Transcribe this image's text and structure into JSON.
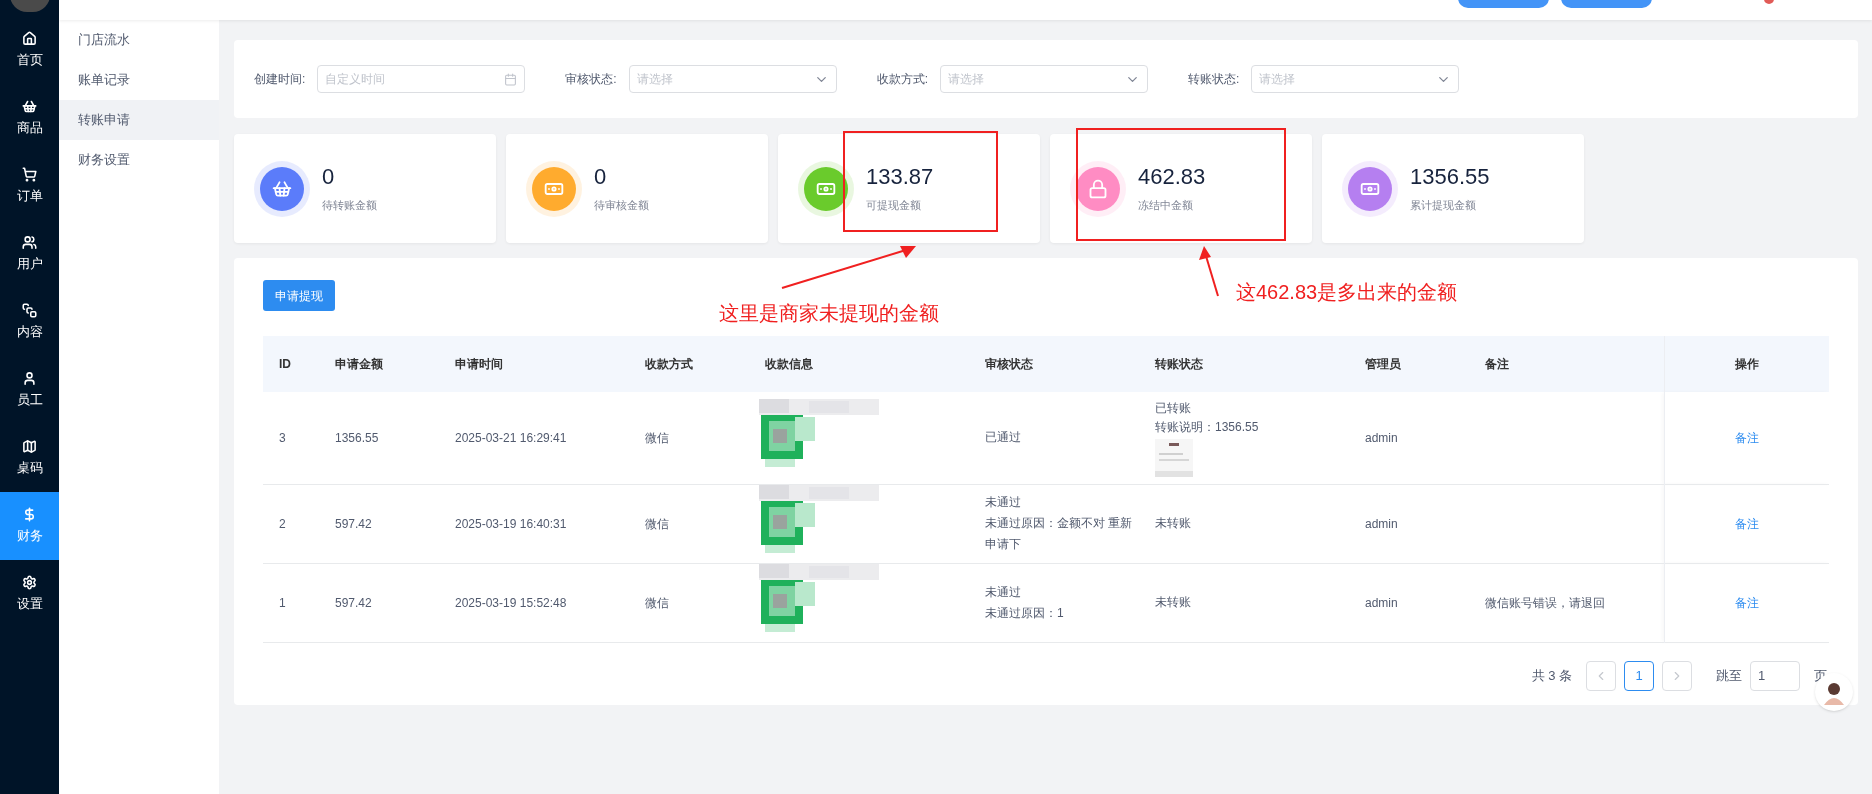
{
  "sidebar": {
    "items": [
      {
        "label": "首页",
        "selected": false
      },
      {
        "label": "商品",
        "selected": false
      },
      {
        "label": "订单",
        "selected": false
      },
      {
        "label": "用户",
        "selected": false
      },
      {
        "label": "内容",
        "selected": false
      },
      {
        "label": "员工",
        "selected": false
      },
      {
        "label": "桌码",
        "selected": false
      },
      {
        "label": "财务",
        "selected": true
      },
      {
        "label": "设置",
        "selected": false
      }
    ]
  },
  "submenu": {
    "items": [
      {
        "label": "门店流水",
        "selected": false
      },
      {
        "label": "账单记录",
        "selected": false
      },
      {
        "label": "转账申请",
        "selected": true
      },
      {
        "label": "财务设置",
        "selected": false
      }
    ]
  },
  "filters": [
    {
      "label": "创建时间:",
      "kind": "date",
      "placeholder": "自定义时间"
    },
    {
      "label": "审核状态:",
      "kind": "select",
      "placeholder": "请选择"
    },
    {
      "label": "收款方式:",
      "kind": "select",
      "placeholder": "请选择"
    },
    {
      "label": "转账状态:",
      "kind": "select",
      "placeholder": "请选择"
    }
  ],
  "stats": [
    {
      "value": "0",
      "label": "待转账金额",
      "color": "#5b7cfa"
    },
    {
      "value": "0",
      "label": "待审核金额",
      "color": "#ffab2e"
    },
    {
      "value": "133.87",
      "label": "可提现金额",
      "color": "#6acb2c"
    },
    {
      "value": "462.83",
      "label": "冻结中金额",
      "color": "#ff8cc3"
    },
    {
      "value": "1356.55",
      "label": "累计提现金额",
      "color": "#b57ff0"
    }
  ],
  "apply_button": "申请提现",
  "table": {
    "columns": [
      "ID",
      "申请金额",
      "申请时间",
      "收款方式",
      "收款信息",
      "审核状态",
      "转账状态",
      "管理员",
      "备注",
      "操作"
    ],
    "rows": [
      {
        "id": "3",
        "amount": "1356.55",
        "time": "2025-03-21 16:29:41",
        "method": "微信",
        "audit": [
          "已通过"
        ],
        "transfer": [
          "已转账",
          "转账说明：1356.55"
        ],
        "proof": {
          "kind": "picture"
        },
        "admin": "admin",
        "action": "备注"
      },
      {
        "id": "2",
        "amount": "597.42",
        "time": "2025-03-19 16:40:31",
        "method": "微信",
        "audit": [
          "未通过",
          "未通过原因：金额不对 重新申请下"
        ],
        "transfer": [
          "未转账"
        ],
        "admin": "admin",
        "action": "备注"
      },
      {
        "id": "1",
        "amount": "597.42",
        "time": "2025-03-19 15:52:48",
        "method": "微信",
        "audit": [
          "未通过",
          "未通过原因：1"
        ],
        "transfer": [
          "未转账"
        ],
        "admin": "admin",
        "remark": "微信账号错误，请退回",
        "action": "备注"
      }
    ]
  },
  "pagination": {
    "total": "共 3 条",
    "pages": [
      {
        "label": "1",
        "selected": true
      }
    ],
    "jump_label": "跳至",
    "jump_value": "1",
    "page_suffix": "页"
  },
  "annotations": [
    {
      "text": "这里是商家未提现的金额"
    },
    {
      "text": "这462.83是多出来的金额"
    }
  ]
}
